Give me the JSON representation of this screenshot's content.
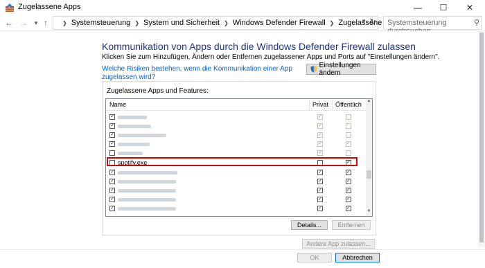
{
  "window": {
    "title": "Zugelassene Apps"
  },
  "address": {
    "crumbs": [
      "Systemsteuerung",
      "System und Sicherheit",
      "Windows Defender Firewall",
      "Zugelassene Apps"
    ],
    "search_placeholder": "Systemsteuerung durchsuchen"
  },
  "main": {
    "heading": "Kommunikation von Apps durch die Windows Defender Firewall zulassen",
    "description": "Klicken Sie zum Hinzufügen, Ändern oder Entfernen zugelassener Apps und Ports auf \"Einstellungen ändern\".",
    "risk_link": "Welche Risiken bestehen, wenn die Kommunikation einer App zugelassen wird?",
    "settings_button": "Einstellungen ändern",
    "group_label": "Zugelassene Apps und Features:",
    "columns": {
      "name": "Name",
      "private": "Privat",
      "public": "Öffentlich"
    },
    "highlighted_app": "spotify.exe",
    "details_button": "Details...",
    "remove_button": "Entfernen",
    "other_app_button": "Andere App zulassen...",
    "ok_button": "OK",
    "cancel_button": "Abbrechen"
  },
  "colors": {
    "heading": "#1e3287",
    "link": "#0066cc",
    "highlight": "#c80a0a"
  }
}
